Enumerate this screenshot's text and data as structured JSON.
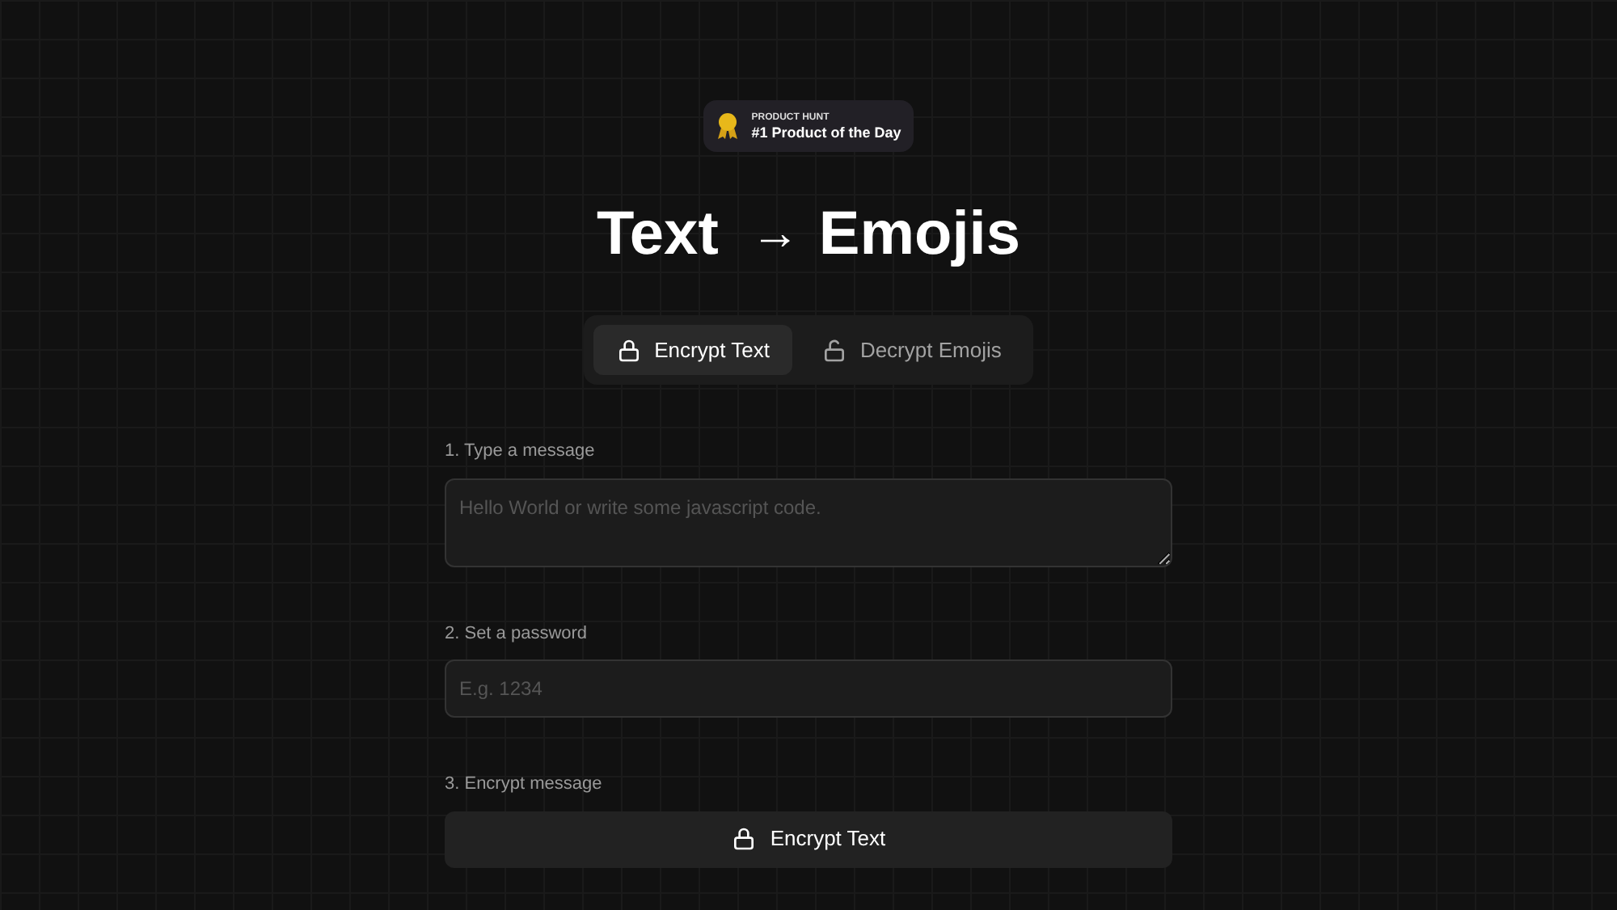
{
  "badge": {
    "eyebrow": "PRODUCT HUNT",
    "title": "#1 Product of the Day"
  },
  "heading": {
    "left": "Text",
    "arrow": "→",
    "right": "Emojis"
  },
  "tabs": [
    {
      "label": "Encrypt Text",
      "selected": true,
      "kind": "lock"
    },
    {
      "label": "Decrypt Emojis",
      "selected": false,
      "kind": "unlock"
    }
  ],
  "message": {
    "label": "1. Type a message",
    "placeholder": "Hello World or write some javascript code."
  },
  "password": {
    "label": "2. Set a password",
    "placeholder": "E.g. 1234"
  },
  "action": {
    "label": "3. Encrypt message",
    "button": "Encrypt Text"
  }
}
